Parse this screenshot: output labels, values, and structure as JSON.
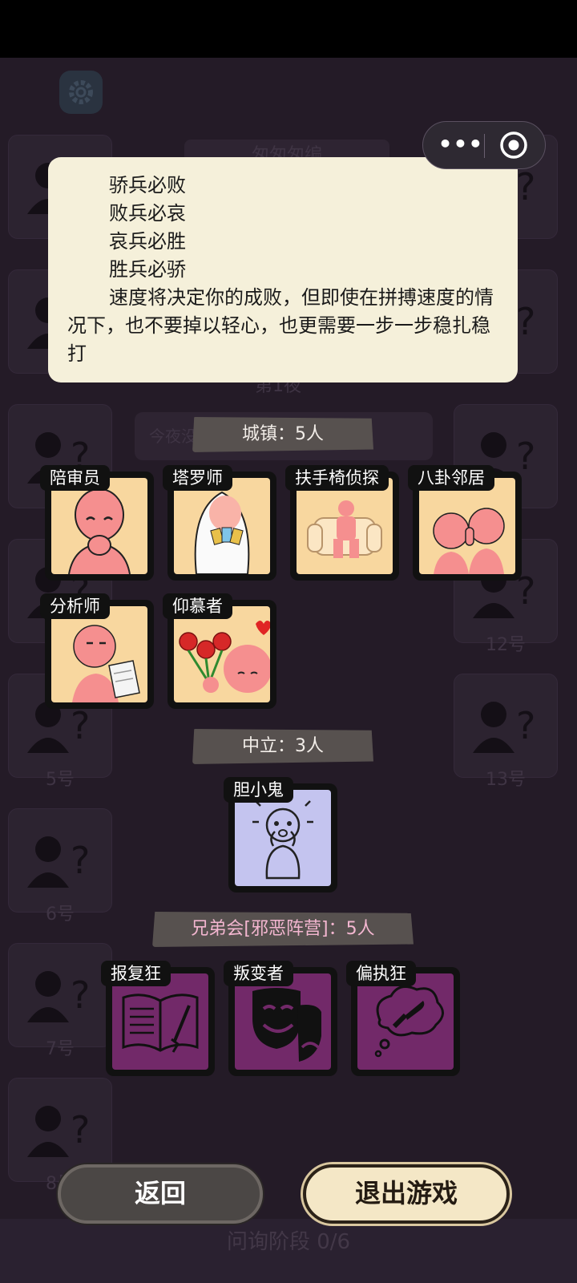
{
  "background": {
    "title": "匆匆匆编",
    "night_label": "第1夜",
    "tonight_text": "今夜没",
    "slots": [
      "",
      "",
      "",
      "",
      "5号",
      "6号",
      "7号",
      "8号",
      "",
      "",
      "",
      "12号",
      "13号"
    ],
    "phase": "问询阶段 0/6"
  },
  "notice": {
    "poem": [
      "骄兵必败",
      "败兵必哀",
      "哀兵必胜",
      "胜兵必骄"
    ],
    "paragraph": "速度将决定你的成败，但即使在拼搏速度的情况下，也不要掉以轻心，也更需要一步一步稳扎稳打"
  },
  "sections": {
    "town": "城镇：5人",
    "neutral": "中立：3人",
    "evil": "兄弟会[邪恶阵营]：5人"
  },
  "roles": {
    "town": [
      "陪审员",
      "塔罗师",
      "扶手椅侦探",
      "八卦邻居",
      "分析师",
      "仰慕者"
    ],
    "neutral": [
      "胆小鬼"
    ],
    "evil": [
      "报复狂",
      "叛变者",
      "偏执狂"
    ]
  },
  "buttons": {
    "back": "返回",
    "exit": "退出游戏"
  },
  "colors": {
    "town_card": "#f8d79f",
    "neutral_card": "#c4c4ef",
    "evil_card": "#722969",
    "notice_bg": "#f5f0da"
  }
}
